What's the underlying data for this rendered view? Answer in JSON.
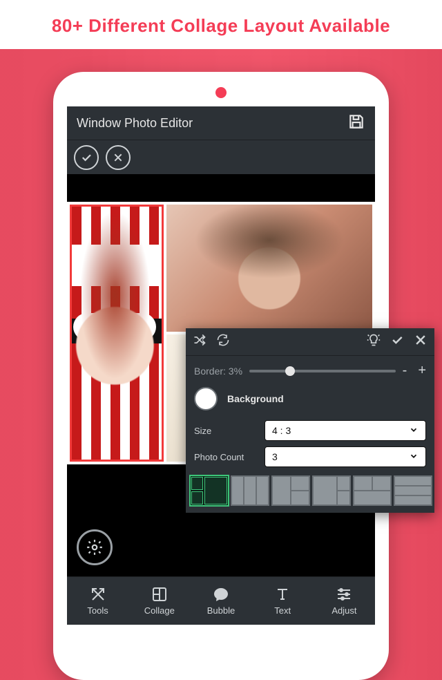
{
  "headline": "80+ Different Collage Layout Available",
  "header": {
    "title": "Window Photo Editor"
  },
  "nav": {
    "items": [
      {
        "label": "Tools"
      },
      {
        "label": "Collage"
      },
      {
        "label": "Bubble"
      },
      {
        "label": "Text"
      },
      {
        "label": "Adjust"
      }
    ]
  },
  "panel": {
    "border_label": "Border: 3%",
    "background_label": "Background",
    "size_label": "Size",
    "size_value": "4 : 3",
    "count_label": "Photo Count",
    "count_value": "3",
    "minus": "-",
    "plus": "+"
  }
}
